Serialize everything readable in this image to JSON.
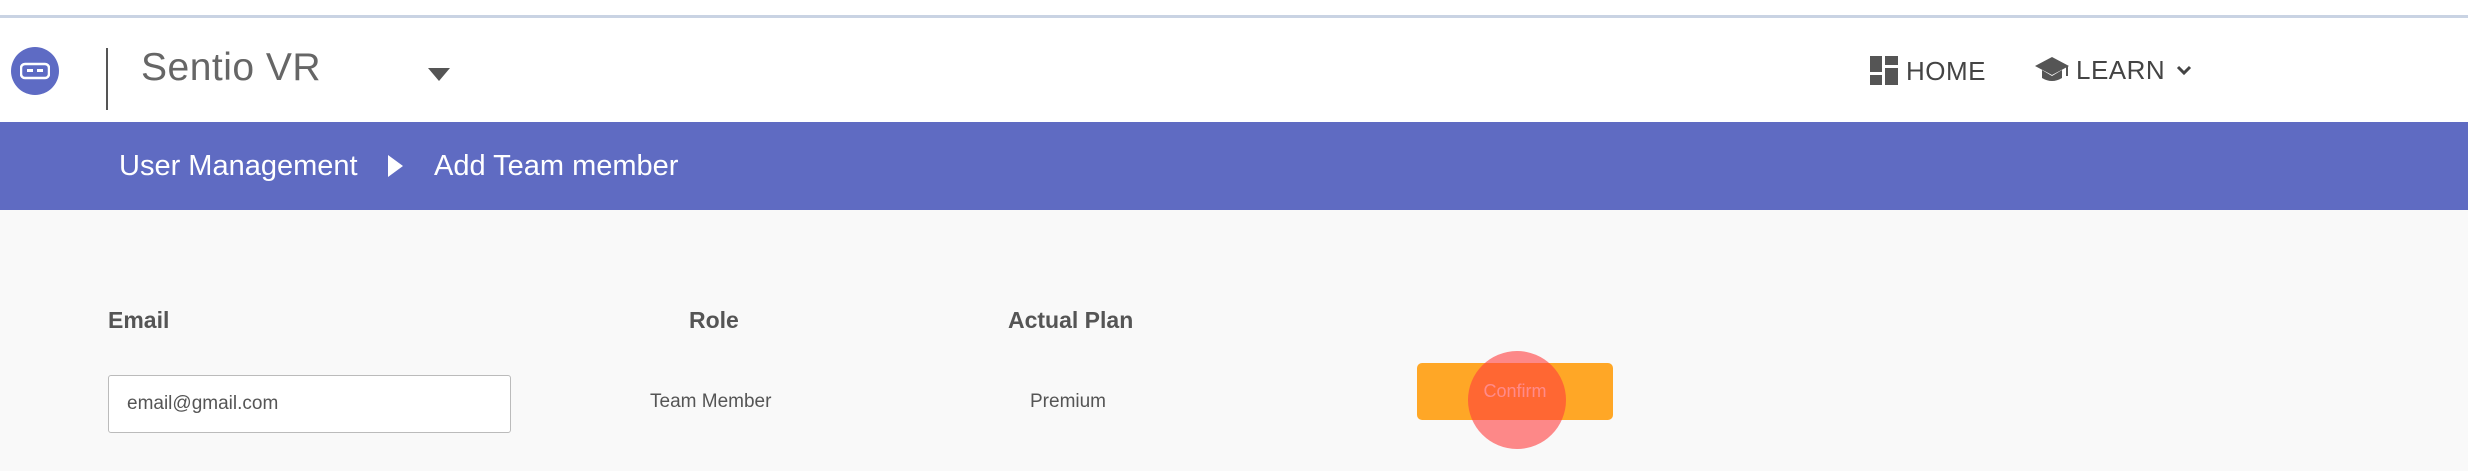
{
  "header": {
    "app_title": "Sentio VR",
    "logo_icon": "vr-headset-icon",
    "nav": {
      "home": {
        "label": "HOME",
        "icon": "dashboard-icon"
      },
      "learn": {
        "label": "LEARN",
        "icon": "graduation-cap-icon"
      }
    }
  },
  "breadcrumb": {
    "parent": "User Management",
    "current": "Add Team member"
  },
  "form": {
    "columns": {
      "email": "Email",
      "role": "Role",
      "plan": "Actual Plan"
    },
    "email_value": "email@gmail.com",
    "role_value": "Team Member",
    "plan_value": "Premium",
    "confirm_label": "Confirm"
  },
  "colors": {
    "brand": "#5f6bc2",
    "confirm": "#ffa726"
  }
}
